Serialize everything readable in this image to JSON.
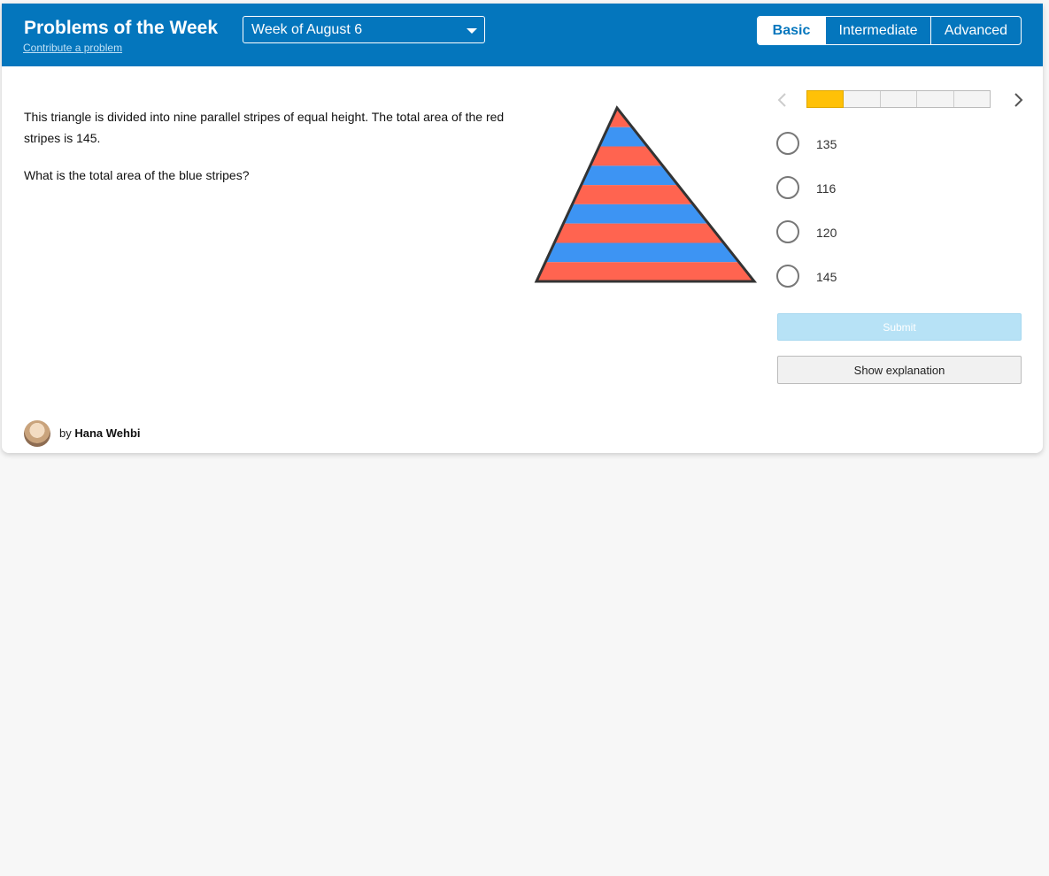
{
  "header": {
    "title": "Problems of the Week",
    "contribute_link": "Contribute a problem",
    "week_selected": "Week of August 6",
    "levels": [
      "Basic",
      "Intermediate",
      "Advanced"
    ],
    "active_level": "Basic"
  },
  "problem": {
    "paragraphs": [
      "This triangle is divided into nine parallel stripes of equal height. The total area of the red stripes is 145.",
      "What is the total area of the blue stripes?"
    ],
    "figure": {
      "shape": "triangle",
      "stripe_count": 9,
      "stripe_colors": [
        "#ff6450",
        "#3d94f3"
      ]
    }
  },
  "answers": {
    "options": [
      "135",
      "116",
      "120",
      "145"
    ],
    "submit_label": "Submit",
    "explanation_label": "Show explanation"
  },
  "progress": {
    "total": 5,
    "current": 1,
    "current_color": "#ffc107"
  },
  "author": {
    "prefix": "by",
    "name": "Hana Wehbi"
  },
  "colors": {
    "header_bg": "#0476bd",
    "submit_bg": "#b7e2f6"
  }
}
